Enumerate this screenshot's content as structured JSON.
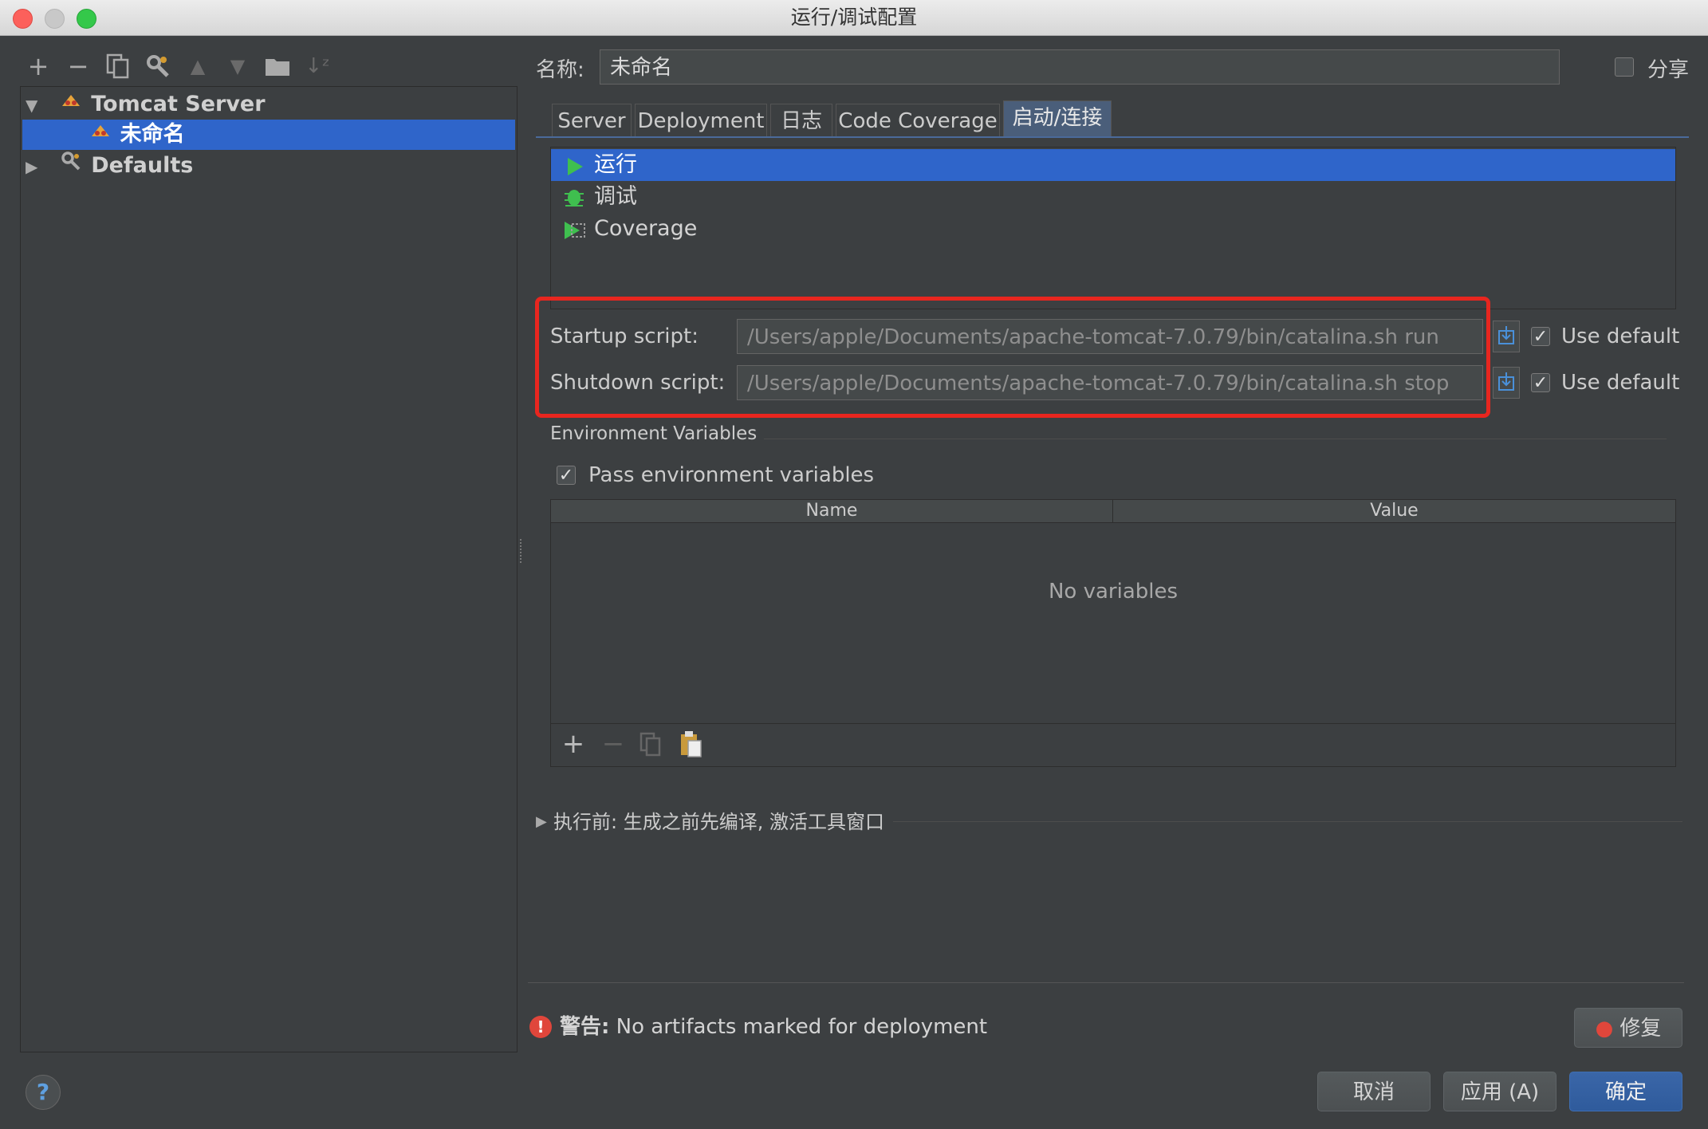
{
  "window": {
    "title": "运行/调试配置"
  },
  "tree": {
    "items": [
      {
        "label": "Tomcat Server",
        "expanded": true
      },
      {
        "label": "未命名",
        "selected": true
      },
      {
        "label": "Defaults",
        "expanded": false
      }
    ]
  },
  "form": {
    "name_label": "名称:",
    "name_value": "未命名",
    "share_label": "分享",
    "share_checked": false
  },
  "tabs": [
    {
      "label": "Server",
      "active": false
    },
    {
      "label": "Deployment",
      "active": false
    },
    {
      "label": "日志",
      "active": false
    },
    {
      "label": "Code Coverage",
      "active": false
    },
    {
      "label": "启动/连接",
      "active": true
    }
  ],
  "modes": [
    {
      "label": "运行",
      "icon": "run-icon",
      "selected": true
    },
    {
      "label": "调试",
      "icon": "debug-bug-icon",
      "selected": false
    },
    {
      "label": "Coverage",
      "icon": "coverage-icon",
      "selected": false
    }
  ],
  "scripts": {
    "startup_label": "Startup script:",
    "startup_value": "/Users/apple/Documents/apache-tomcat-7.0.79/bin/catalina.sh run",
    "shutdown_label": "Shutdown script:",
    "shutdown_value": "/Users/apple/Documents/apache-tomcat-7.0.79/bin/catalina.sh stop",
    "use_default_label": "Use default",
    "startup_use_default": true,
    "shutdown_use_default": true
  },
  "env": {
    "section_title": "Environment Variables",
    "pass_label": "Pass environment variables",
    "pass_checked": true,
    "col_name": "Name",
    "col_value": "Value",
    "empty_text": "No variables"
  },
  "before_launch": {
    "label": "执行前: 生成之前先编译, 激活工具窗口"
  },
  "warning": {
    "prefix": "警告:",
    "text": "No artifacts marked for deployment",
    "fix_label": "修复"
  },
  "footer": {
    "help": "?",
    "cancel": "取消",
    "apply": "应用 (A)",
    "ok": "确定"
  },
  "colors": {
    "background": "#3c3f41",
    "selection": "#2f65ca",
    "highlight_box": "#e8261f",
    "run_green": "#3fbf4f"
  }
}
